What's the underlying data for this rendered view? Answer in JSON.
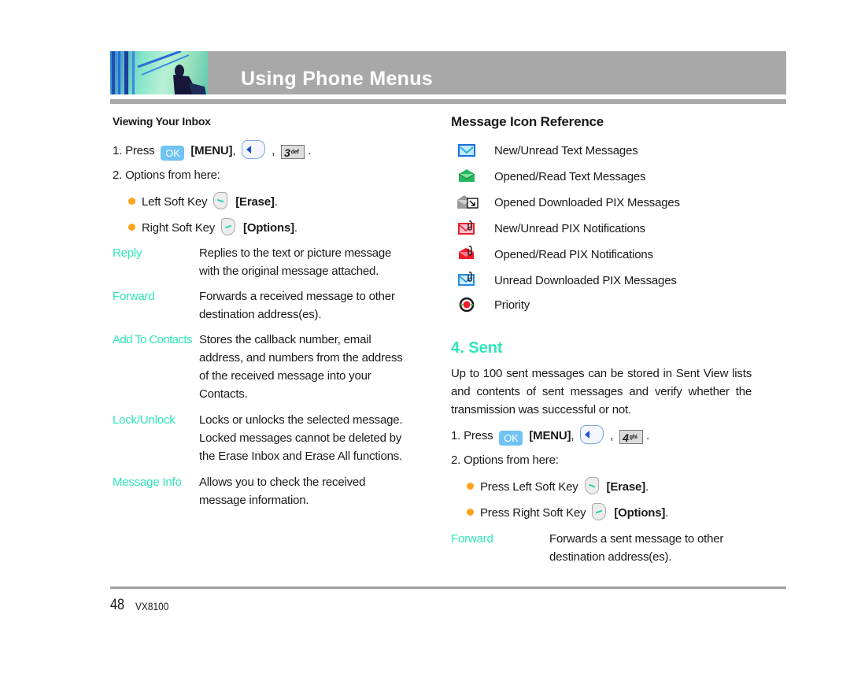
{
  "header": {
    "title": "Using Phone Menus"
  },
  "left": {
    "section_title": "Viewing Your Inbox",
    "step1": {
      "prefix": "1. Press",
      "menu": "[MENU]",
      "comma": ",",
      "num_key": "3",
      "num_sub": "def",
      "end": "."
    },
    "step2": "2. Options from here:",
    "bullets": [
      {
        "text": "Left Soft Key",
        "action": "[Erase]",
        "end": "."
      },
      {
        "text": "Right Soft Key",
        "action": "[Options]",
        "end": "."
      }
    ],
    "options": [
      {
        "term": "Reply",
        "lines": [
          "Replies to the text or picture message",
          "with the original message attached."
        ]
      },
      {
        "term": "Forward",
        "lines": [
          "Forwards a received message to other",
          "destination address(es)."
        ]
      },
      {
        "term": "Add To Contacts",
        "lines": [
          "Stores the callback number, email",
          "address, and numbers from the address",
          "of the received message into your",
          "Contacts."
        ]
      },
      {
        "term": "Lock/Unlock",
        "lines": [
          "Locks or unlocks the selected message.",
          "Locked messages cannot be deleted by",
          "the Erase Inbox and Erase All functions."
        ]
      },
      {
        "term": "Message Info",
        "lines": [
          "Allows you to check the received",
          "message information."
        ]
      }
    ]
  },
  "right": {
    "icon_ref_title": "Message Icon Reference",
    "icons": [
      {
        "icon": "new-unread-text-icon",
        "label": "New/Unread Text Messages"
      },
      {
        "icon": "opened-read-text-icon",
        "label": "Opened/Read Text Messages"
      },
      {
        "icon": "opened-downloaded-pix-icon",
        "label": "Opened Downloaded PIX Messages"
      },
      {
        "icon": "new-unread-pix-notification-icon",
        "label": "New/Unread PIX Notifications"
      },
      {
        "icon": "opened-read-pix-notification-icon",
        "label": "Opened/Read PIX Notifications"
      },
      {
        "icon": "unread-downloaded-pix-icon",
        "label": "Unread Downloaded PIX Messages"
      },
      {
        "icon": "priority-icon",
        "label": "Priority"
      }
    ],
    "sent_title": "4. Sent",
    "sent_para": [
      "Up to 100 sent messages can be stored in Sent View lists",
      "and contents of sent messages and verify whether the",
      "transmission was successful or not."
    ],
    "step1": {
      "prefix": "1. Press",
      "menu": "[MENU]",
      "comma": ",",
      "num_key": "4",
      "num_sub": "ghi",
      "end": "."
    },
    "step2": "2. Options from here:",
    "bullets": [
      {
        "text": "Press Left Soft Key",
        "action": "[Erase]",
        "end": "."
      },
      {
        "text": "Press Right Soft Key",
        "action": "[Options]",
        "end": "."
      }
    ],
    "options": [
      {
        "term": "Forward",
        "lines": [
          "Forwards a sent message to other",
          "destination address(es)."
        ]
      }
    ]
  },
  "keys": {
    "ok_label": "OK"
  },
  "footer": {
    "page_number": "48",
    "model": "VX8100"
  },
  "colors": {
    "accent": "#2ee6b8",
    "bullet": "#ffa31a",
    "header_gray": "#a8a8a8"
  }
}
